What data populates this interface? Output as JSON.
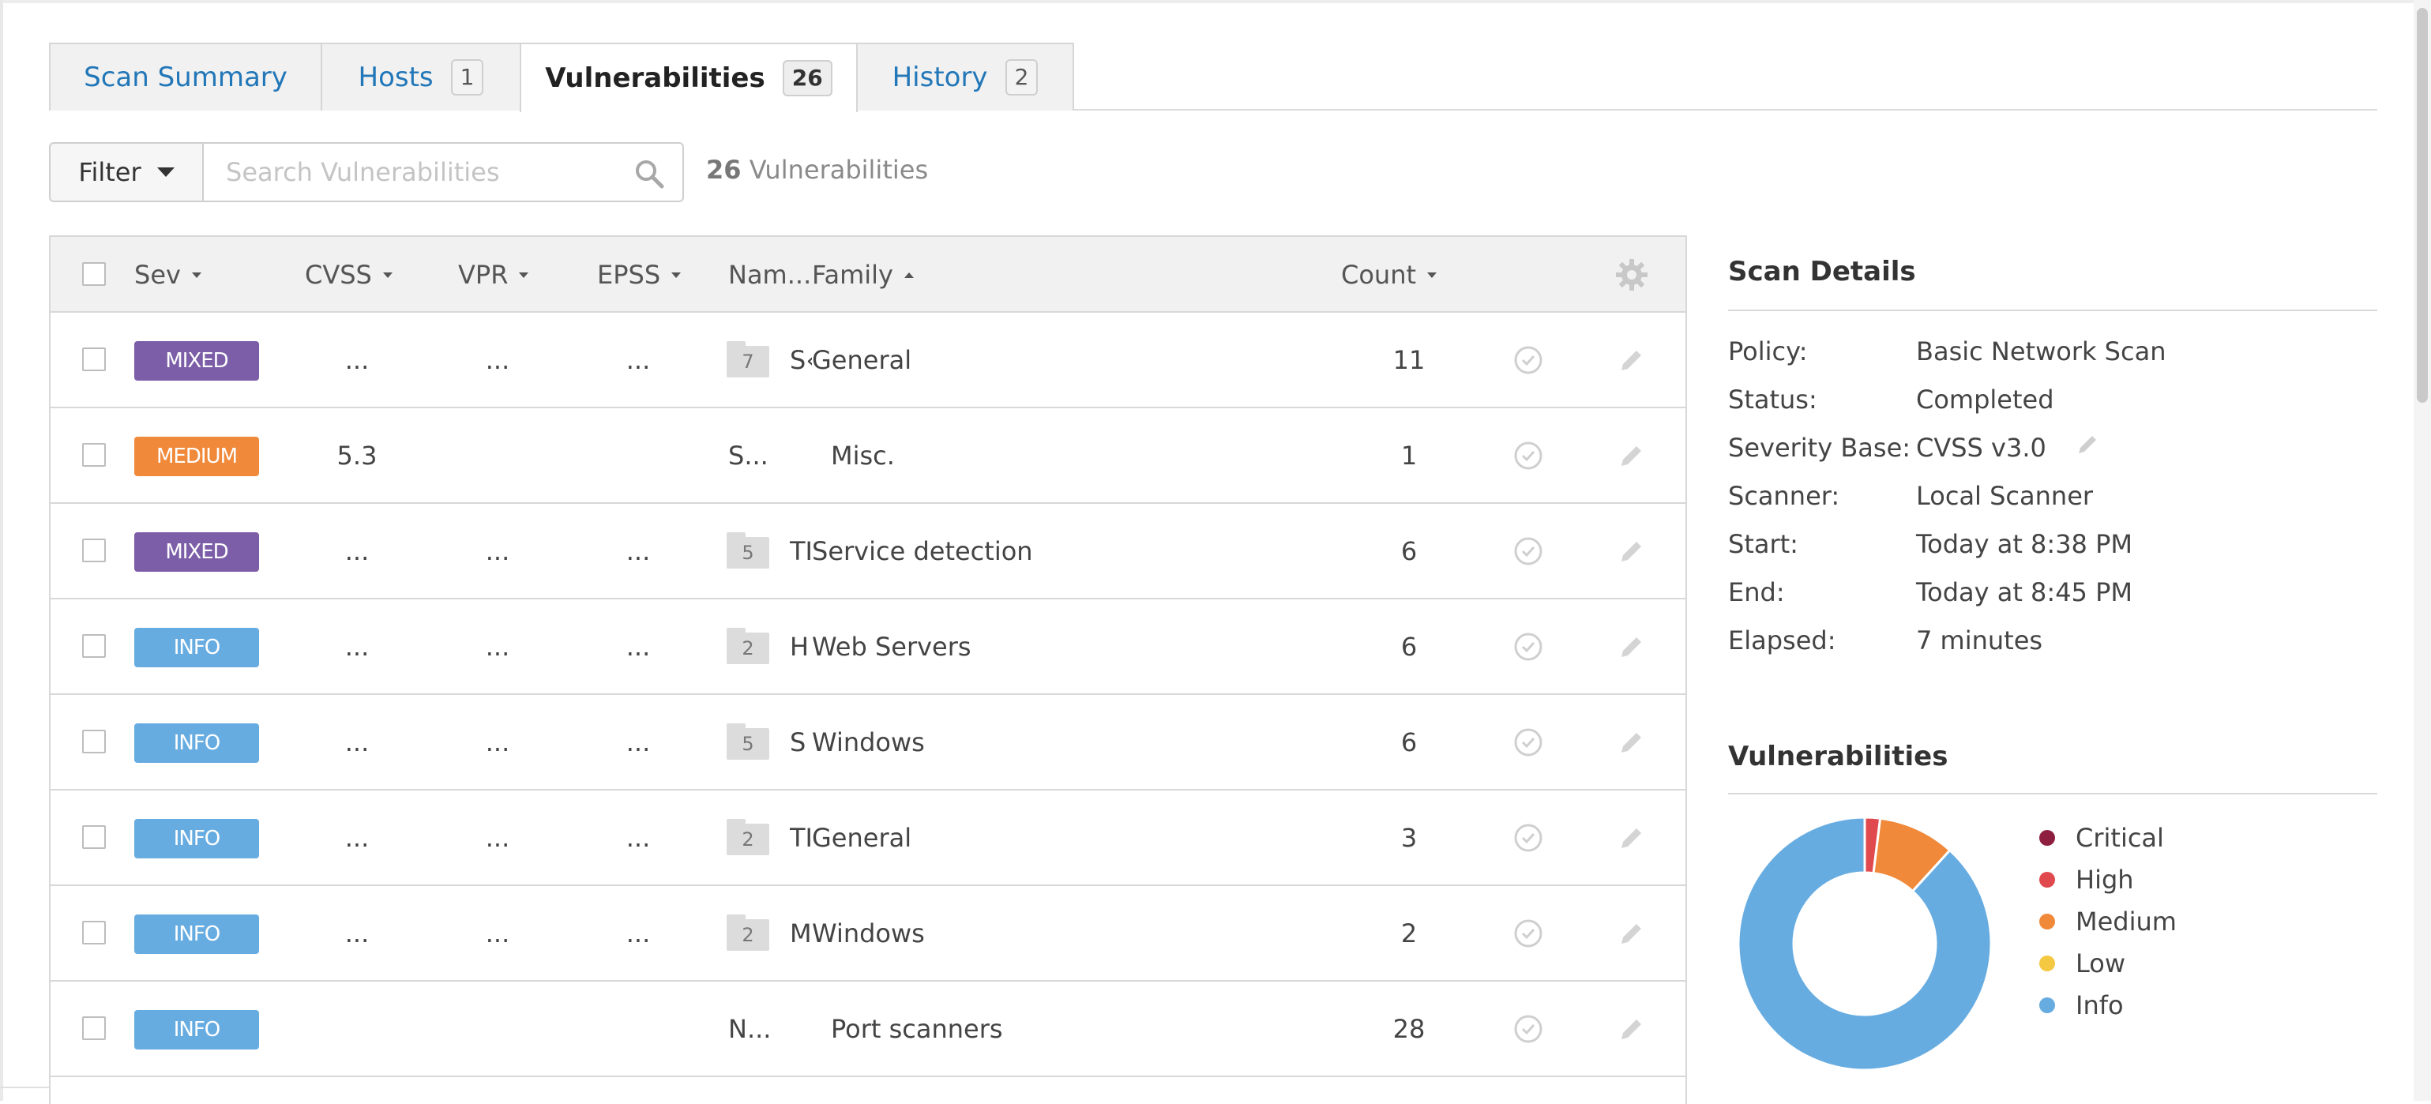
{
  "tabs": [
    {
      "label": "Scan Summary",
      "count": ""
    },
    {
      "label": "Hosts",
      "count": "1"
    },
    {
      "label": "Vulnerabilities",
      "count": "26"
    },
    {
      "label": "History",
      "count": "2"
    }
  ],
  "filter": {
    "button_label": "Filter",
    "search_placeholder": "Search Vulnerabilities",
    "count_number": "26",
    "count_label": "Vulnerabilities"
  },
  "table": {
    "headers": {
      "sev": "Sev",
      "cvss": "CVSS",
      "vpr": "VPR",
      "epss": "EPSS",
      "name": "Nam...",
      "family": "Family",
      "count": "Count"
    },
    "rows": [
      {
        "sev": "MIXED",
        "sev_color": "#7b5ea7",
        "cvss": "...",
        "vpr": "...",
        "epss": "...",
        "folder": "7",
        "name": "S‹",
        "family": "General",
        "count": "11"
      },
      {
        "sev": "MEDIUM",
        "sev_color": "#f0893a",
        "cvss": "5.3",
        "vpr": "",
        "epss": "",
        "folder": "",
        "name": "S...",
        "family": "Misc.",
        "count": "1"
      },
      {
        "sev": "MIXED",
        "sev_color": "#7b5ea7",
        "cvss": "...",
        "vpr": "...",
        "epss": "...",
        "folder": "5",
        "name": "TI",
        "family": "Service detection",
        "count": "6"
      },
      {
        "sev": "INFO",
        "sev_color": "#67ace1",
        "cvss": "...",
        "vpr": "...",
        "epss": "...",
        "folder": "2",
        "name": "H",
        "family": "Web Servers",
        "count": "6"
      },
      {
        "sev": "INFO",
        "sev_color": "#67ace1",
        "cvss": "...",
        "vpr": "...",
        "epss": "...",
        "folder": "5",
        "name": "S",
        "family": "Windows",
        "count": "6"
      },
      {
        "sev": "INFO",
        "sev_color": "#67ace1",
        "cvss": "...",
        "vpr": "...",
        "epss": "...",
        "folder": "2",
        "name": "TI",
        "family": "General",
        "count": "3"
      },
      {
        "sev": "INFO",
        "sev_color": "#67ace1",
        "cvss": "...",
        "vpr": "...",
        "epss": "...",
        "folder": "2",
        "name": "M",
        "family": "Windows",
        "count": "2"
      },
      {
        "sev": "INFO",
        "sev_color": "#67ace1",
        "cvss": "",
        "vpr": "",
        "epss": "",
        "folder": "",
        "name": "N...",
        "family": "Port scanners",
        "count": "28"
      }
    ]
  },
  "scan_details": {
    "title": "Scan Details",
    "items": [
      {
        "label": "Policy:",
        "value": "Basic Network Scan"
      },
      {
        "label": "Status:",
        "value": "Completed"
      },
      {
        "label": "Severity Base:",
        "value": "CVSS v3.0"
      },
      {
        "label": "Scanner:",
        "value": "Local Scanner"
      },
      {
        "label": "Start:",
        "value": "Today at 8:38 PM"
      },
      {
        "label": "End:",
        "value": "Today at 8:45 PM"
      },
      {
        "label": "Elapsed:",
        "value": "7 minutes"
      }
    ]
  },
  "vulnerabilities_chart": {
    "title": "Vulnerabilities",
    "legend": [
      {
        "label": "Critical",
        "color": "#8e1f3f"
      },
      {
        "label": "High",
        "color": "#e04a4f"
      },
      {
        "label": "Medium",
        "color": "#f0893a"
      },
      {
        "label": "Low",
        "color": "#f5c842"
      },
      {
        "label": "Info",
        "color": "#67ace1"
      }
    ]
  },
  "chart_data": {
    "type": "pie",
    "categories": [
      "Critical",
      "High",
      "Medium",
      "Low",
      "Info"
    ],
    "values": [
      0,
      1,
      5,
      0,
      45
    ],
    "title": "Vulnerabilities"
  }
}
